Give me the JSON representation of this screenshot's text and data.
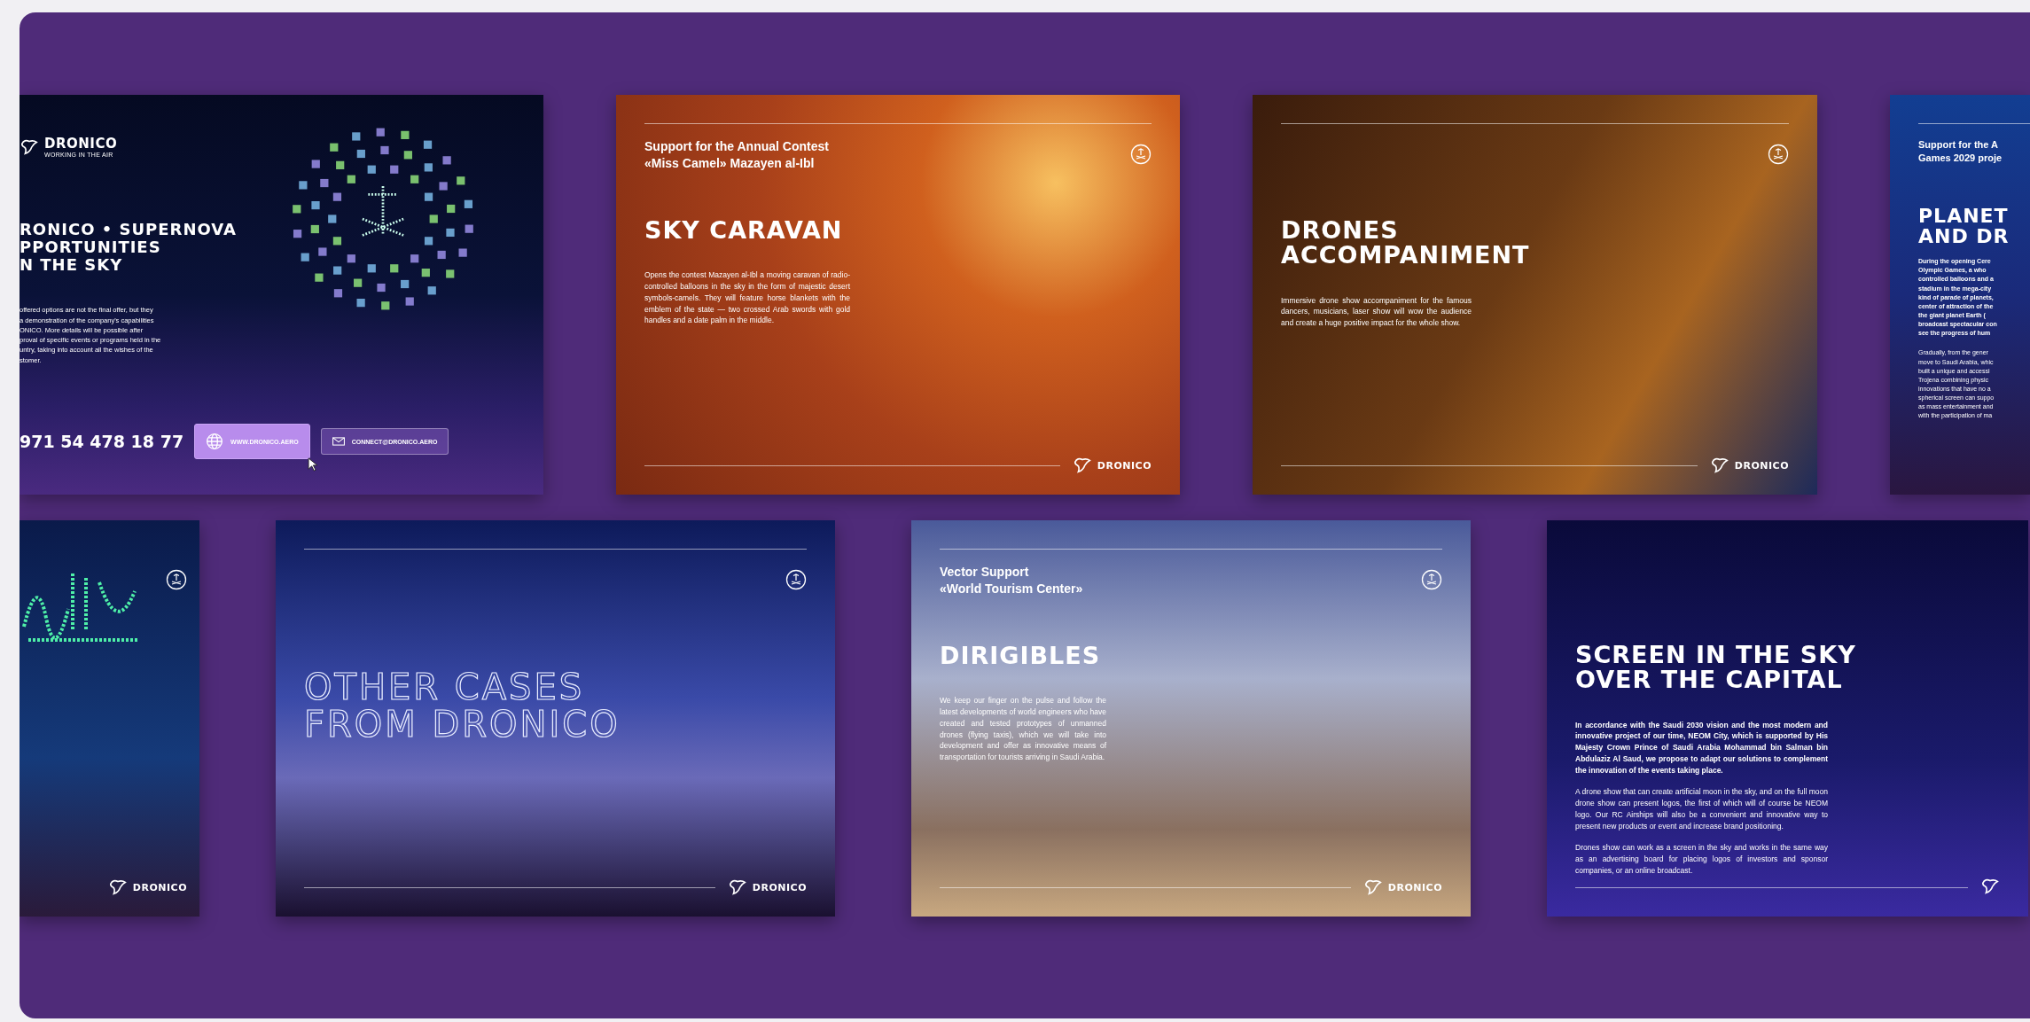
{
  "rows": [
    {
      "slides": [
        {
          "kind": "contact",
          "logo": {
            "name": "DRONICO",
            "tagline": "WORKING IN THE AIR"
          },
          "emblem": false,
          "title_lines": [
            "RONICO • SUPERNOVA",
            "PPORTUNITIES",
            "N THE SKY"
          ],
          "paragraphs": [
            {
              "bold": false,
              "lines": [
                "offered options are not the final offer, but they",
                "a demonstration of the company's capabilities",
                "ONICO. More details will be possible after",
                "proval of specific events or programs held in the",
                "untry, taking into account all the wishes of the",
                "stomer."
              ]
            }
          ],
          "phone": "971 54 478 18 77",
          "links": [
            {
              "kind": "web",
              "label": "WWW.DRONICO.AERO",
              "hovered": true
            },
            {
              "kind": "mail",
              "label": "CONNECT@DRONICO.AERO",
              "hovered": false
            }
          ]
        },
        {
          "kind": "case",
          "subtitle_lines": [
            "Support for the Annual Contest",
            "«Miss Camel» Mazayen al-Ibl"
          ],
          "emblem": true,
          "title_lines": [
            "SKY CARAVAN"
          ],
          "paragraphs": [
            {
              "bold": false,
              "text": "Opens the contest Mazayen al-Ibl a moving caravan of radio-controlled balloons in the sky in the form of majestic desert symbols-camels. They will feature horse blankets with the emblem of the state — two crossed Arab swords with gold handles and a date palm in the middle."
            }
          ],
          "logo": {
            "name": "DRONICO"
          }
        },
        {
          "kind": "case",
          "emblem": true,
          "title_lines": [
            "DRONES",
            "ACCOMPANIMENT"
          ],
          "paragraphs": [
            {
              "bold": false,
              "text": "Immersive drone show accompaniment for the famous dancers, musicians, laser show will wow the audience and create a huge positive impact for the whole show."
            }
          ],
          "logo": {
            "name": "DRONICO"
          }
        },
        {
          "kind": "case",
          "subtitle_lines": [
            "Support for the A",
            "Games 2029 proje"
          ],
          "emblem": false,
          "title_lines": [
            "PLANET",
            "AND DR"
          ],
          "paragraphs": [
            {
              "bold": true,
              "lines": [
                "During the opening Cere",
                "Olympic Games, a who",
                "controlled balloons and a",
                "stadium in the mega-city",
                "kind of parade of planets,",
                "center of attraction of the",
                "the giant planet Earth (",
                "broadcast spectacular con",
                "see the progress of hum"
              ]
            },
            {
              "bold": false,
              "lines": [
                "Gradually, from the gener",
                "move to Saudi Arabia, whic",
                "built a unique and accessi",
                "Trojena combining physic",
                "innovations that have no a",
                "spherical screen can suppo",
                "as mass entertainment and",
                "with the participation of ma"
              ]
            }
          ]
        }
      ]
    },
    {
      "slides": [
        {
          "kind": "graphic",
          "emblem": true,
          "logo": {
            "name": "DRONICO"
          }
        },
        {
          "kind": "cover",
          "emblem": true,
          "title_lines": [
            "OTHER CASES",
            "FROM DRONICO"
          ],
          "logo": {
            "name": "DRONICO"
          }
        },
        {
          "kind": "case",
          "subtitle_lines": [
            "Vector Support",
            "«World Tourism Center»"
          ],
          "emblem": true,
          "title_lines": [
            "DIRIGIBLES"
          ],
          "paragraphs": [
            {
              "bold": false,
              "text": "We keep our finger on the pulse and follow the latest developments of world engineers who have created and tested prototypes of unmanned drones (flying taxis), which we will take into development and offer as innovative means of transportation for tourists arriving in Saudi Arabia."
            }
          ],
          "logo": {
            "name": "DRONICO"
          }
        },
        {
          "kind": "case",
          "emblem": false,
          "title_lines": [
            "SCREEN IN THE SKY",
            "OVER THE CAPITAL"
          ],
          "paragraphs": [
            {
              "bold": true,
              "text": "In accordance with the Saudi 2030 vision and the most modern and innovative project of our time, NEOM City, which is supported by His Majesty Crown Prince of Saudi Arabia Mohammad bin Salman bin Abdulaziz Al Saud, we propose to adapt our solutions to complement the innovation of the events taking place."
            },
            {
              "bold": false,
              "text": "A drone show that can create artificial moon in the sky, and on the full moon drone show can present logos, the first of which will of course be NEOM logo. Our RC Airships will also be a convenient and innovative way to present new products or event and increase brand positioning."
            },
            {
              "bold": false,
              "text": "Drones show can work as a screen in the sky and works in the same way as an advertising board for placing logos of investors and sponsor companies, or an online broadcast."
            }
          ],
          "logo_mark": true
        }
      ]
    }
  ]
}
